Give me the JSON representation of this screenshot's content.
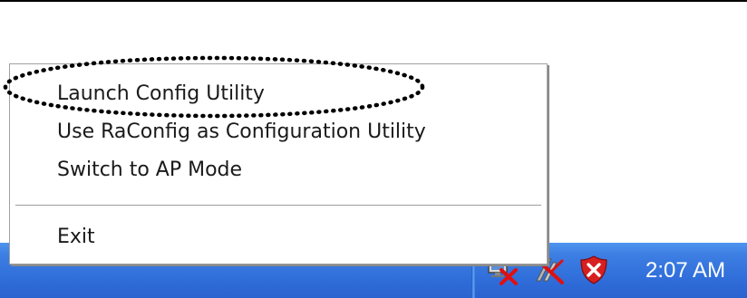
{
  "context_menu": {
    "items": [
      {
        "label": "Launch Config Utility"
      },
      {
        "label": "Use RaConfig as Configuration Utility"
      },
      {
        "label": "Switch to AP Mode"
      },
      {
        "label": "Exit"
      }
    ],
    "highlighted_item": "Launch Config Utility"
  },
  "taskbar": {
    "clock": "2:07 AM",
    "tray_icons": [
      "network-disconnected-icon",
      "wireless-disabled-icon",
      "security-alert-icon"
    ],
    "background_color": "#2f6cd9"
  }
}
